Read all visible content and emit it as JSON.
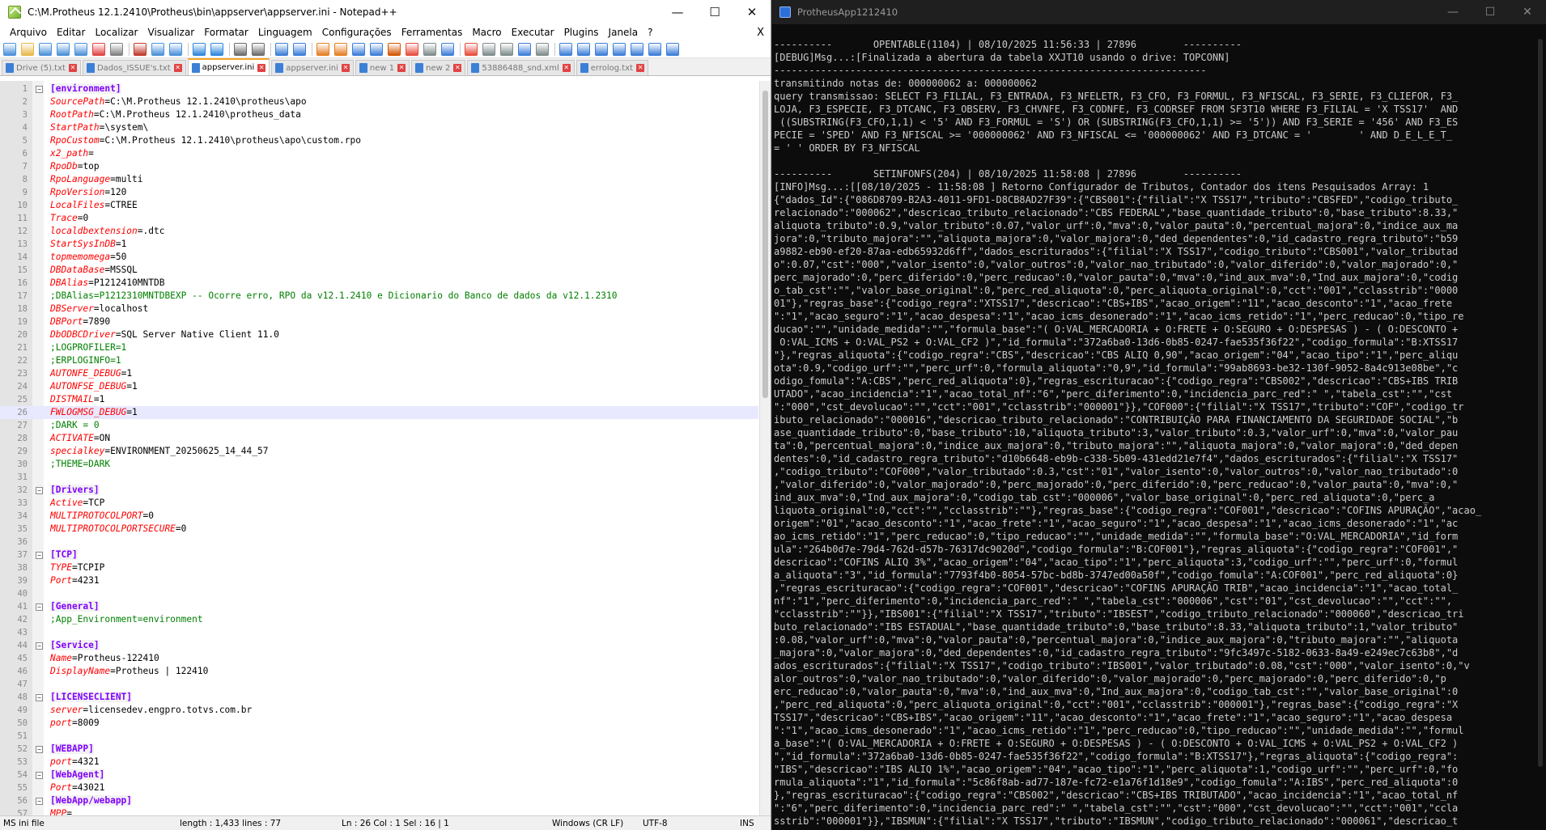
{
  "npp": {
    "title": "C:\\M.Protheus 12.1.2410\\Protheus\\bin\\appserver\\appserver.ini - Notepad++",
    "menu": [
      "Arquivo",
      "Editar",
      "Localizar",
      "Visualizar",
      "Formatar",
      "Linguagem",
      "Configurações",
      "Ferramentas",
      "Macro",
      "Executar",
      "Plugins",
      "Janela",
      "?"
    ],
    "menu_close": "X",
    "tabs": [
      {
        "label": "Drive (5).txt",
        "active": false
      },
      {
        "label": "Dados_ISSUE's.txt",
        "active": false
      },
      {
        "label": "appserver.ini",
        "active": true
      },
      {
        "label": "appserver.ini",
        "active": false
      },
      {
        "label": "new 1",
        "active": false
      },
      {
        "label": "new 2",
        "active": false
      },
      {
        "label": "53886488_snd.xml",
        "active": false
      },
      {
        "label": "errolog.txt",
        "active": false
      }
    ],
    "lines": [
      {
        "n": "1",
        "type": "section",
        "fold": true,
        "text": "[environment]"
      },
      {
        "n": "2",
        "type": "kv",
        "k": "SourcePath",
        "v": "C:\\M.Protheus 12.1.2410\\protheus\\apo"
      },
      {
        "n": "3",
        "type": "kv",
        "k": "RootPath",
        "v": "C:\\M.Protheus 12.1.2410\\protheus_data"
      },
      {
        "n": "4",
        "type": "kv",
        "k": "StartPath",
        "v": "\\system\\"
      },
      {
        "n": "5",
        "type": "kv",
        "k": "RpoCustom",
        "v": "C:\\M.Protheus 12.1.2410\\protheus\\apo\\custom.rpo"
      },
      {
        "n": "6",
        "type": "kv",
        "k": "x2_path",
        "v": ""
      },
      {
        "n": "7",
        "type": "kv",
        "k": "RpoDb",
        "v": "top"
      },
      {
        "n": "8",
        "type": "kv",
        "k": "RpoLanguage",
        "v": "multi"
      },
      {
        "n": "9",
        "type": "kv",
        "k": "RpoVersion",
        "v": "120"
      },
      {
        "n": "10",
        "type": "kv",
        "k": "LocalFiles",
        "v": "CTREE"
      },
      {
        "n": "11",
        "type": "kv",
        "k": "Trace",
        "v": "0"
      },
      {
        "n": "12",
        "type": "kv",
        "k": "localdbextension",
        "v": ".dtc"
      },
      {
        "n": "13",
        "type": "kv",
        "k": "StartSysInDB",
        "v": "1"
      },
      {
        "n": "14",
        "type": "kv",
        "k": "topmemomega",
        "v": "50"
      },
      {
        "n": "15",
        "type": "kv",
        "k": "DBDataBase",
        "v": "MSSQL"
      },
      {
        "n": "16",
        "type": "kv",
        "k": "DBAlias",
        "v": "P1212410MNTDB"
      },
      {
        "n": "17",
        "type": "comment",
        "text": ";DBAlias=P1212310MNTDBEXP -- Ocorre erro, RPO da v12.1.2410 e Dicionario do Banco de dados da v12.1.2310"
      },
      {
        "n": "18",
        "type": "kv",
        "k": "DBServer",
        "v": "localhost"
      },
      {
        "n": "19",
        "type": "kv",
        "k": "DBPort",
        "v": "7890"
      },
      {
        "n": "20",
        "type": "kv",
        "k": "DbODBCDriver",
        "v": "SQL Server Native Client 11.0"
      },
      {
        "n": "21",
        "type": "comment",
        "text": ";LOGPROFILER=1"
      },
      {
        "n": "22",
        "type": "comment",
        "text": ";ERPLOGINFO=1"
      },
      {
        "n": "23",
        "type": "kv",
        "k": "AUTONFE_DEBUG",
        "v": "1"
      },
      {
        "n": "24",
        "type": "kv",
        "k": "AUTONFSE_DEBUG",
        "v": "1"
      },
      {
        "n": "25",
        "type": "kv",
        "k": "DISTMAIL",
        "v": "1"
      },
      {
        "n": "26",
        "type": "kv",
        "k": "FWLOGMSG_DEBUG",
        "v": "1",
        "current": true
      },
      {
        "n": "27",
        "type": "comment",
        "text": ";DARK = 0"
      },
      {
        "n": "28",
        "type": "kv",
        "k": "ACTIVATE",
        "v": "ON"
      },
      {
        "n": "29",
        "type": "kv",
        "k": "specialkey",
        "v": "ENVIRONMENT_20250625_14_44_57"
      },
      {
        "n": "30",
        "type": "comment",
        "text": ";THEME=DARK"
      },
      {
        "n": "31",
        "type": "blank"
      },
      {
        "n": "32",
        "type": "section",
        "fold": true,
        "text": "[Drivers]"
      },
      {
        "n": "33",
        "type": "kv",
        "k": "Active",
        "v": "TCP"
      },
      {
        "n": "34",
        "type": "kv",
        "k": "MULTIPROTOCOLPORT",
        "v": "0"
      },
      {
        "n": "35",
        "type": "kv",
        "k": "MULTIPROTOCOLPORTSECURE",
        "v": "0"
      },
      {
        "n": "36",
        "type": "blank"
      },
      {
        "n": "37",
        "type": "section",
        "fold": true,
        "text": "[TCP]"
      },
      {
        "n": "38",
        "type": "kv",
        "k": "TYPE",
        "v": "TCPIP"
      },
      {
        "n": "39",
        "type": "kv",
        "k": "Port",
        "v": "4231"
      },
      {
        "n": "40",
        "type": "blank"
      },
      {
        "n": "41",
        "type": "section",
        "fold": true,
        "text": "[General]"
      },
      {
        "n": "42",
        "type": "comment",
        "text": ";App_Environment=environment"
      },
      {
        "n": "43",
        "type": "blank"
      },
      {
        "n": "44",
        "type": "section",
        "fold": true,
        "text": "[Service]"
      },
      {
        "n": "45",
        "type": "kv",
        "k": "Name",
        "v": "Protheus-122410"
      },
      {
        "n": "46",
        "type": "kv",
        "k": "DisplayName",
        "v": "Protheus | 122410"
      },
      {
        "n": "47",
        "type": "blank"
      },
      {
        "n": "48",
        "type": "section",
        "fold": true,
        "text": "[LICENSECLIENT]"
      },
      {
        "n": "49",
        "type": "kv",
        "k": "server",
        "v": "licensedev.engpro.totvs.com.br"
      },
      {
        "n": "50",
        "type": "kv",
        "k": "port",
        "v": "8009"
      },
      {
        "n": "51",
        "type": "blank"
      },
      {
        "n": "52",
        "type": "section",
        "fold": true,
        "text": "[WEBAPP]"
      },
      {
        "n": "53",
        "type": "kv",
        "k": "port",
        "v": "4321"
      },
      {
        "n": "54",
        "type": "section",
        "fold": true,
        "text": "[WebAgent]"
      },
      {
        "n": "55",
        "type": "kv",
        "k": "Port",
        "v": "43021"
      },
      {
        "n": "56",
        "type": "section",
        "fold": true,
        "text": "[WebApp/webapp]"
      },
      {
        "n": "57",
        "type": "kv",
        "k": "MPP",
        "v": ""
      }
    ],
    "status": {
      "type": "MS ini file",
      "length": "length : 1,433    lines : 77",
      "position": "Ln : 26    Col : 1    Sel : 16 | 1",
      "eol": "Windows (CR LF)",
      "encoding": "UTF-8",
      "mode": "INS"
    }
  },
  "console": {
    "title": "ProtheusApp1212410",
    "lines": [
      "----------       OPENTABLE(1104) | 08/10/2025 11:56:33 | 27896        ----------",
      "[DEBUG]Msg...:[Finalizada a abertura da tabela XXJT10 usando o drive: TOPCONN]",
      "--------------------------------------------------------------------------",
      "transmitindo notas de: 000000062 a: 000000062",
      "query transmissao: SELECT F3_FILIAL, F3_ENTRADA, F3_NFELETR, F3_CFO, F3_FORMUL, F3_NFISCAL, F3_SERIE, F3_CLIEFOR, F3_",
      "LOJA, F3_ESPECIE, F3_DTCANC, F3_OBSERV, F3_CHVNFE, F3_CODNFE, F3_CODRSEF FROM SF3T10 WHERE F3_FILIAL = 'X TSS17'  AND",
      " ((SUBSTRING(F3_CFO,1,1) < '5' AND F3_FORMUL = 'S') OR (SUBSTRING(F3_CFO,1,1) >= '5')) AND F3_SERIE = '456' AND F3_ES",
      "PECIE = 'SPED' AND F3_NFISCAL >= '000000062' AND F3_NFISCAL <= '000000062' AND F3_DTCANC = '        ' AND D_E_L_E_T_",
      "= ' ' ORDER BY F3_NFISCAL",
      "",
      "----------       SETINFONFS(204) | 08/10/2025 11:58:08 | 27896        ----------",
      "[INFO]Msg...:[[08/10/2025 - 11:58:08 ] Retorno Configurador de Tributos, Contador dos itens Pesquisados Array: 1",
      "{\"dados_Id\":{\"086D8709-B2A3-4011-9FD1-D8CB8AD27F39\":{\"CBS001\":{\"filial\":\"X TSS17\",\"tributo\":\"CBSFED\",\"codigo_tributo_",
      "relacionado\":\"000062\",\"descricao_tributo_relacionado\":\"CBS FEDERAL\",\"base_quantidade_tributo\":0,\"base_tributo\":8.33,\"",
      "aliquota_tributo\":0.9,\"valor_tributo\":0.07,\"valor_urf\":0,\"mva\":0,\"valor_pauta\":0,\"percentual_majora\":0,\"indice_aux_ma",
      "jora\":0,\"tributo_majora\":\"\",\"aliquota_majora\":0,\"valor_majora\":0,\"ded_dependentes\":0,\"id_cadastro_regra_tributo\":\"b59",
      "a9882-eb90-ef20-87aa-edb65932d6ff\",\"dados_escriturados\":{\"filial\":\"X TSS17\",\"codigo_tributo\":\"CBS001\",\"valor_tributad",
      "o\":0.07,\"cst\":\"000\",\"valor_isento\":0,\"valor_outros\":0,\"valor_nao_tributado\":0,\"valor_diferido\":0,\"valor_majorado\":0,\"",
      "perc_majorado\":0,\"perc_diferido\":0,\"perc_reducao\":0,\"valor_pauta\":0,\"mva\":0,\"ind_aux_mva\":0,\"Ind_aux_majora\":0,\"codig",
      "o_tab_cst\":\"\",\"valor_base_original\":0,\"perc_red_aliquota\":0,\"perc_aliquota_original\":0,\"cct\":\"001\",\"cclasstrib\":\"0000",
      "01\"},\"regras_base\":{\"codigo_regra\":\"XTSS17\",\"descricao\":\"CBS+IBS\",\"acao_origem\":\"11\",\"acao_desconto\":\"1\",\"acao_frete",
      "\":\"1\",\"acao_seguro\":\"1\",\"acao_despesa\":\"1\",\"acao_icms_desonerado\":\"1\",\"acao_icms_retido\":\"1\",\"perc_reducao\":0,\"tipo_re",
      "ducao\":\"\",\"unidade_medida\":\"\",\"formula_base\":\"( O:VAL_MERCADORIA + O:FRETE + O:SEGURO + O:DESPESAS ) - ( O:DESCONTO +",
      " O:VAL_ICMS + O:VAL_PS2 + O:VAL_CF2 )\",\"id_formula\":\"372a6ba0-13d6-0b85-0247-fae535f36f22\",\"codigo_formula\":\"B:XTSS17",
      "\"},\"regras_aliquota\":{\"codigo_regra\":\"CBS\",\"descricao\":\"CBS ALIQ 0,90\",\"acao_origem\":\"04\",\"acao_tipo\":\"1\",\"perc_aliqu",
      "ota\":0.9,\"codigo_urf\":\"\",\"perc_urf\":0,\"formula_aliquota\":\"0,9\",\"id_formula\":\"99ab8693-be32-130f-9052-8a4c913e08be\",\"c",
      "odigo_fomula\":\"A:CBS\",\"perc_red_aliquota\":0},\"regras_escrituracao\":{\"codigo_regra\":\"CBS002\",\"descricao\":\"CBS+IBS TRIB",
      "UTADO\",\"acao_incidencia\":\"1\",\"acao_total_nf\":\"6\",\"perc_diferimento\":0,\"incidencia_parc_red\":\" \",\"tabela_cst\":\"\",\"cst",
      "\":\"000\",\"cst_devolucao\":\"\",\"cct\":\"001\",\"cclasstrib\":\"000001\"}},\"COF000\":{\"filial\":\"X TSS17\",\"tributo\":\"COF\",\"codigo_tr",
      "ibuto_relacionado\":\"000016\",\"descricao_tributo_relacionado\":\"CONTRIBUIÇÃO PARA FINANCIAMENTO DA SEGURIDADE SOCIAL\",\"b",
      "ase_quantidade_tributo\":0,\"base_tributo\":10,\"aliquota_tributo\":3,\"valor_tributo\":0.3,\"valor_urf\":0,\"mva\":0,\"valor_pau",
      "ta\":0,\"percentual_majora\":0,\"indice_aux_majora\":0,\"tributo_majora\":\"\",\"aliquota_majora\":0,\"valor_majora\":0,\"ded_depen",
      "dentes\":0,\"id_cadastro_regra_tributo\":\"d10b6648-eb9b-c338-5b09-431edd21e7f4\",\"dados_escriturados\":{\"filial\":\"X TSS17\"",
      ",\"codigo_tributo\":\"COF000\",\"valor_tributado\":0.3,\"cst\":\"01\",\"valor_isento\":0,\"valor_outros\":0,\"valor_nao_tributado\":0",
      ",\"valor_diferido\":0,\"valor_majorado\":0,\"perc_majorado\":0,\"perc_diferido\":0,\"perc_reducao\":0,\"valor_pauta\":0,\"mva\":0,\"",
      "ind_aux_mva\":0,\"Ind_aux_majora\":0,\"codigo_tab_cst\":\"000006\",\"valor_base_original\":0,\"perc_red_aliquota\":0,\"perc_a",
      "liquota_original\":0,\"cct\":\"\",\"cclasstrib\":\"\"},\"regras_base\":{\"codigo_regra\":\"COF001\",\"descricao\":\"COFINS APURAÇÃO\",\"acao_",
      "origem\":\"01\",\"acao_desconto\":\"1\",\"acao_frete\":\"1\",\"acao_seguro\":\"1\",\"acao_despesa\":\"1\",\"acao_icms_desonerado\":\"1\",\"ac",
      "ao_icms_retido\":\"1\",\"perc_reducao\":0,\"tipo_reducao\":\"\",\"unidade_medida\":\"\",\"formula_base\":\"O:VAL_MERCADORIA\",\"id_form",
      "ula\":\"264b0d7e-79d4-762d-d57b-76317dc9020d\",\"codigo_formula\":\"B:COF001\"},\"regras_aliquota\":{\"codigo_regra\":\"COF001\",\"",
      "descricao\":\"COFINS ALIQ 3%\",\"acao_origem\":\"04\",\"acao_tipo\":\"1\",\"perc_aliquota\":3,\"codigo_urf\":\"\",\"perc_urf\":0,\"formul",
      "a_aliquota\":\"3\",\"id_formula\":\"7793f4b0-8054-57bc-bd8b-3747ed00a50f\",\"codigo_fomula\":\"A:COF001\",\"perc_red_aliquota\":0}",
      ",\"regras_escrituracao\":{\"codigo_regra\":\"COF001\",\"descricao\":\"COFINS APURAÇÃO TRIB\",\"acao_incidencia\":\"1\",\"acao_total_",
      "nf\":\"1\",\"perc_diferimento\":0,\"incidencia_parc_red\":\" \",\"tabela_cst\":\"000006\",\"cst\":\"01\",\"cst_devolucao\":\"\",\"cct\":\"\",",
      "\"cclasstrib\":\"\"}},\"IBS001\":{\"filial\":\"X TSS17\",\"tributo\":\"IBSEST\",\"codigo_tributo_relacionado\":\"000060\",\"descricao_tri",
      "buto_relacionado\":\"IBS ESTADUAL\",\"base_quantidade_tributo\":0,\"base_tributo\":8.33,\"aliquota_tributo\":1,\"valor_tributo\"",
      ":0.08,\"valor_urf\":0,\"mva\":0,\"valor_pauta\":0,\"percentual_majora\":0,\"indice_aux_majora\":0,\"tributo_majora\":\"\",\"aliquota",
      "_majora\":0,\"valor_majora\":0,\"ded_dependentes\":0,\"id_cadastro_regra_tributo\":\"9fc3497c-5182-0633-8a49-e249ec7c63b8\",\"d",
      "ados_escriturados\":{\"filial\":\"X TSS17\",\"codigo_tributo\":\"IBS001\",\"valor_tributado\":0.08,\"cst\":\"000\",\"valor_isento\":0,\"v",
      "alor_outros\":0,\"valor_nao_tributado\":0,\"valor_diferido\":0,\"valor_majorado\":0,\"perc_majorado\":0,\"perc_diferido\":0,\"p",
      "erc_reducao\":0,\"valor_pauta\":0,\"mva\":0,\"ind_aux_mva\":0,\"Ind_aux_majora\":0,\"codigo_tab_cst\":\"\",\"valor_base_original\":0",
      ",\"perc_red_aliquota\":0,\"perc_aliquota_original\":0,\"cct\":\"001\",\"cclasstrib\":\"000001\"},\"regras_base\":{\"codigo_regra\":\"X",
      "TSS17\",\"descricao\":\"CBS+IBS\",\"acao_origem\":\"11\",\"acao_desconto\":\"1\",\"acao_frete\":\"1\",\"acao_seguro\":\"1\",\"acao_despesa",
      "\":\"1\",\"acao_icms_desonerado\":\"1\",\"acao_icms_retido\":\"1\",\"perc_reducao\":0,\"tipo_reducao\":\"\",\"unidade_medida\":\"\",\"formul",
      "a_base\":\"( O:VAL_MERCADORIA + O:FRETE + O:SEGURO + O:DESPESAS ) - ( O:DESCONTO + O:VAL_ICMS + O:VAL_PS2 + O:VAL_CF2 )",
      "\",\"id_formula\":\"372a6ba0-13d6-0b85-0247-fae535f36f22\",\"codigo_formula\":\"B:XTSS17\"},\"regras_aliquota\":{\"codigo_regra\":",
      "\"IBS\",\"descricao\":\"IBS ALIQ 1%\",\"acao_origem\":\"04\",\"acao_tipo\":\"1\",\"perc_aliquota\":1,\"codigo_urf\":\"\",\"perc_urf\":0,\"fo",
      "rmula_aliquota\":\"1\",\"id_formula\":\"5c86f8ab-ad77-187e-fc72-e1a76f1d18e9\",\"codigo_fomula\":\"A:IBS\",\"perc_red_aliquota\":0",
      "},\"regras_escrituracao\":{\"codigo_regra\":\"CBS002\",\"descricao\":\"CBS+IBS TRIBUTADO\",\"acao_incidencia\":\"1\",\"acao_total_nf",
      "\":\"6\",\"perc_diferimento\":0,\"incidencia_parc_red\":\" \",\"tabela_cst\":\"\",\"cst\":\"000\",\"cst_devolucao\":\"\",\"cct\":\"001\",\"ccla",
      "sstrib\":\"000001\"}},\"IBSMUN\":{\"filial\":\"X TSS17\",\"tributo\":\"IBSMUN\",\"codigo_tributo_relacionado\":\"000061\",\"descricao_t"
    ]
  }
}
